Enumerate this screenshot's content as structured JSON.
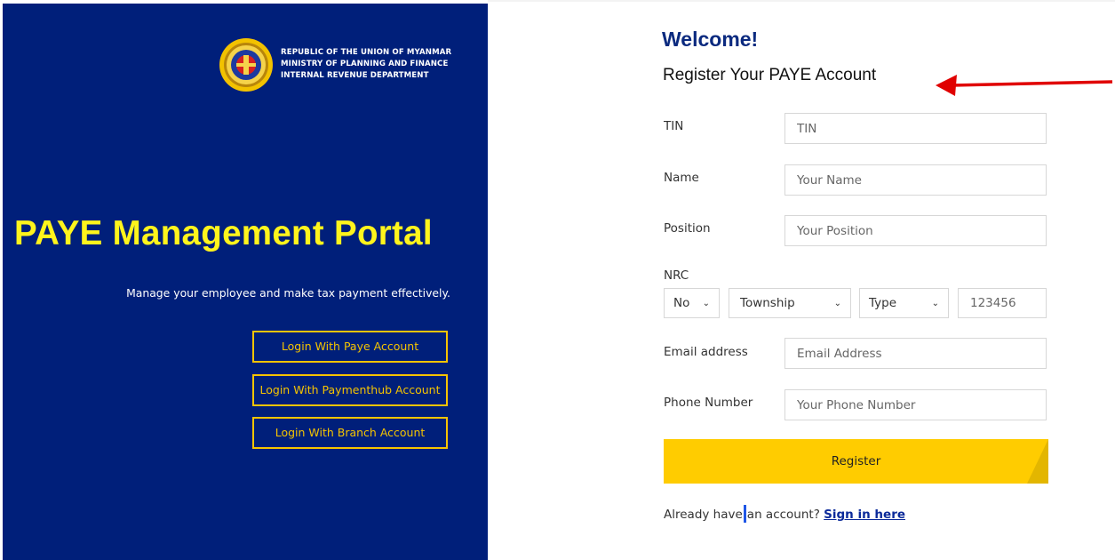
{
  "left_panel": {
    "org_lines": [
      "REPUBLIC OF THE UNION OF MYANMAR",
      "MINISTRY OF PLANNING AND FINANCE",
      "INTERNAL REVENUE DEPARTMENT"
    ],
    "portal_title": "PAYE Management Portal",
    "tagline": "Manage your employee and make tax payment effectively.",
    "buttons": [
      "Login With Paye Account",
      "Login With Paymenthub Account",
      "Login With Branch Account"
    ],
    "colors": {
      "background": "#001f7a",
      "title": "#fff41c",
      "button_border": "#f5c400"
    },
    "logo_icon": "ird-seal-icon"
  },
  "form": {
    "welcome": "Welcome!",
    "subtitle": "Register Your PAYE Account",
    "fields": {
      "tin": {
        "label": "TIN",
        "placeholder": "TIN"
      },
      "name": {
        "label": "Name",
        "placeholder": "Your Name"
      },
      "position": {
        "label": "Position",
        "placeholder": "Your Position"
      },
      "email": {
        "label": "Email address",
        "placeholder": "Email Address"
      },
      "phone": {
        "label": "Phone Number",
        "placeholder": "Your Phone Number"
      }
    },
    "nrc": {
      "label": "NRC",
      "no_value": "No",
      "township_value": "Township",
      "type_value": "Type",
      "number_placeholder": "123456"
    },
    "register_label": "Register",
    "already_text_a": "Already have",
    "already_text_b": "an account?",
    "signin_label": "Sign in here",
    "colors": {
      "heading": "#0b2a7f",
      "register_bg": "#ffcc00",
      "annotation_arrow": "#e00000"
    }
  }
}
